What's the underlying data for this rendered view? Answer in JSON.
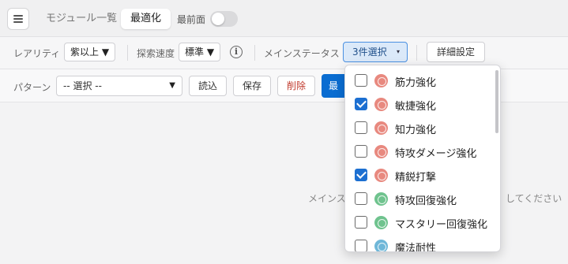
{
  "header": {
    "tabs": [
      {
        "label": "モジュール一覧",
        "active": false
      },
      {
        "label": "最適化",
        "active": true
      }
    ],
    "topmost_label": "最前面",
    "topmost_toggle_on": false
  },
  "filters": {
    "rarity_label": "レアリティ",
    "rarity_value": "紫以上 ▼",
    "speed_label": "探索速度",
    "speed_value": "標準 ▼",
    "info_icon": "i",
    "main_stat_label": "メインステータス",
    "main_stat_value": "3件選択",
    "main_stat_arrow": "▾",
    "advanced_button": "詳細設定"
  },
  "pattern": {
    "label": "パターン",
    "placeholder": "-- 選択 --",
    "caret": "▼",
    "load_button": "読込",
    "save_button": "保存",
    "delete_button": "削除",
    "primary_button": "最"
  },
  "main": {
    "message_left": "メインス",
    "message_right": "してください"
  },
  "dropdown": {
    "options": [
      {
        "label": "筋力強化",
        "checked": false,
        "icon": "strength-icon",
        "icon_color": "#e8897f"
      },
      {
        "label": "敏捷強化",
        "checked": true,
        "icon": "agility-icon",
        "icon_color": "#e8897f"
      },
      {
        "label": "知力強化",
        "checked": false,
        "icon": "intellect-icon",
        "icon_color": "#e8897f"
      },
      {
        "label": "特攻ダメージ強化",
        "checked": false,
        "icon": "special-damage-icon",
        "icon_color": "#e8897f"
      },
      {
        "label": "精鋭打撃",
        "checked": true,
        "icon": "elite-strike-icon",
        "icon_color": "#e8897f"
      },
      {
        "label": "特攻回復強化",
        "checked": false,
        "icon": "special-heal-icon",
        "icon_color": "#6fc38e"
      },
      {
        "label": "マスタリー回復強化",
        "checked": false,
        "icon": "mastery-heal-icon",
        "icon_color": "#6fc38e"
      },
      {
        "label": "魔法耐性",
        "checked": false,
        "icon": "magic-resist-icon",
        "icon_color": "#6fb7d8"
      }
    ]
  }
}
